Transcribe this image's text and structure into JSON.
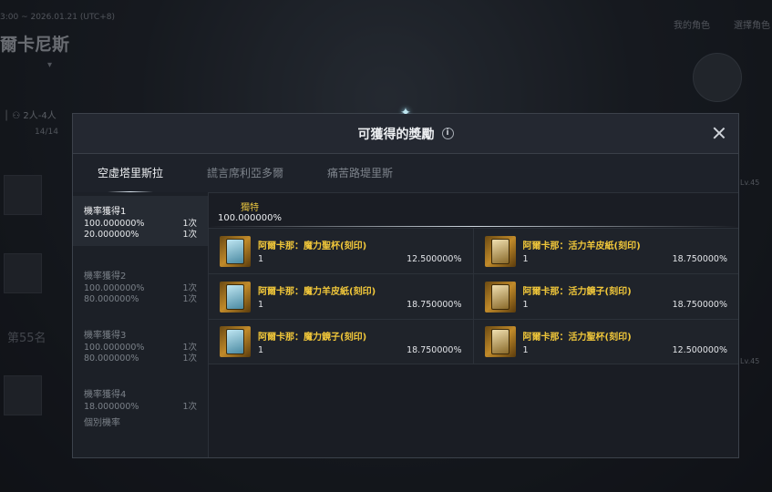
{
  "background": {
    "date_range": "3:00 ~ 2026.01.21 (UTC+8)",
    "title": "爾卡尼斯",
    "players": "2人-4人",
    "count": "14/14",
    "rank": "第55名",
    "my_character": "我的角色",
    "choose_character": "選擇角色",
    "level": "Lv.45"
  },
  "modal": {
    "title": "可獲得的獎勵",
    "info_icon": "i",
    "tabs": [
      {
        "label": "空虛塔里斯拉",
        "active": true
      },
      {
        "label": "謊言席利亞多爾",
        "active": false
      },
      {
        "label": "痛苦路堤里斯",
        "active": false
      }
    ],
    "sidebar": {
      "groups": [
        {
          "title": "機率獲得1",
          "rows": [
            {
              "pct": "100.000000%",
              "times": "1次"
            },
            {
              "pct": "20.000000%",
              "times": "1次"
            }
          ],
          "active": true
        },
        {
          "title": "機率獲得2",
          "rows": [
            {
              "pct": "100.000000%",
              "times": "1次"
            },
            {
              "pct": "80.000000%",
              "times": "1次"
            }
          ],
          "active": false
        },
        {
          "title": "機率獲得3",
          "rows": [
            {
              "pct": "100.000000%",
              "times": "1次"
            },
            {
              "pct": "80.000000%",
              "times": "1次"
            }
          ],
          "active": false
        },
        {
          "title": "機率獲得4",
          "rows": [
            {
              "pct": "18.000000%",
              "times": "1次"
            }
          ],
          "active": false
        }
      ],
      "individual": "個別機率"
    },
    "rarity": {
      "label": "獨特",
      "value": "100.000000%"
    },
    "rewards": [
      {
        "name": "阿爾卡那：魔力聖杯(刻印)",
        "qty": "1",
        "pct": "12.500000%",
        "icon": "card-icon"
      },
      {
        "name": "阿爾卡那：活力羊皮紙(刻印)",
        "qty": "1",
        "pct": "18.750000%",
        "icon": "card-icon"
      },
      {
        "name": "阿爾卡那：魔力羊皮紙(刻印)",
        "qty": "1",
        "pct": "18.750000%",
        "icon": "card-icon"
      },
      {
        "name": "阿爾卡那：活力鏡子(刻印)",
        "qty": "1",
        "pct": "18.750000%",
        "icon": "card-icon"
      },
      {
        "name": "阿爾卡那：魔力鏡子(刻印)",
        "qty": "1",
        "pct": "18.750000%",
        "icon": "card-icon"
      },
      {
        "name": "阿爾卡那：活力聖杯(刻印)",
        "qty": "1",
        "pct": "12.500000%",
        "icon": "card-icon"
      }
    ]
  }
}
